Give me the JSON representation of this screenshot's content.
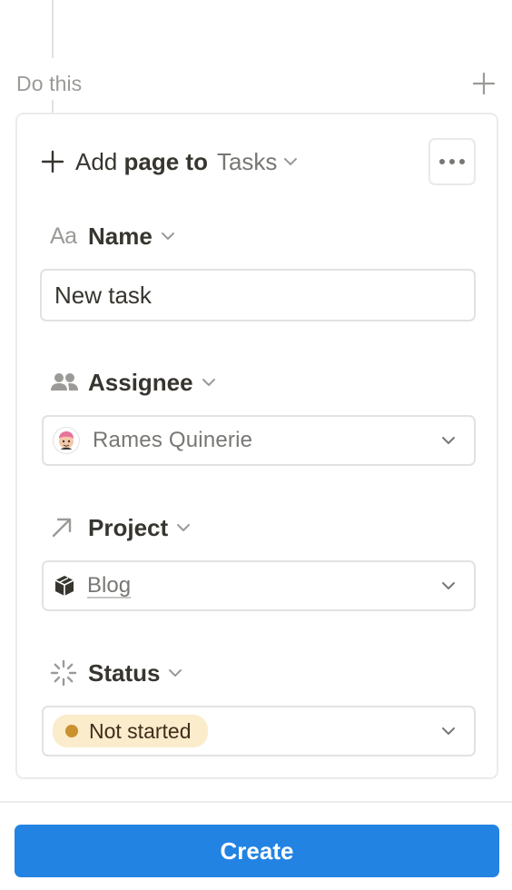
{
  "section": {
    "title": "Do this"
  },
  "card": {
    "add_prefix": "Add ",
    "add_bold": "page to",
    "database_name": "Tasks"
  },
  "properties": {
    "name": {
      "label": "Name",
      "icon": "Aa",
      "value": "New task"
    },
    "assignee": {
      "label": "Assignee",
      "value": "Rames Quinerie"
    },
    "project": {
      "label": "Project",
      "value": "Blog"
    },
    "status": {
      "label": "Status",
      "value": "Not started",
      "pill_color": "#fbeccb",
      "dot_color": "#cb912f"
    }
  },
  "footer": {
    "create_label": "Create"
  },
  "colors": {
    "accent": "#2383e2",
    "muted_text": "#787774",
    "border": "#e3e2e0"
  }
}
